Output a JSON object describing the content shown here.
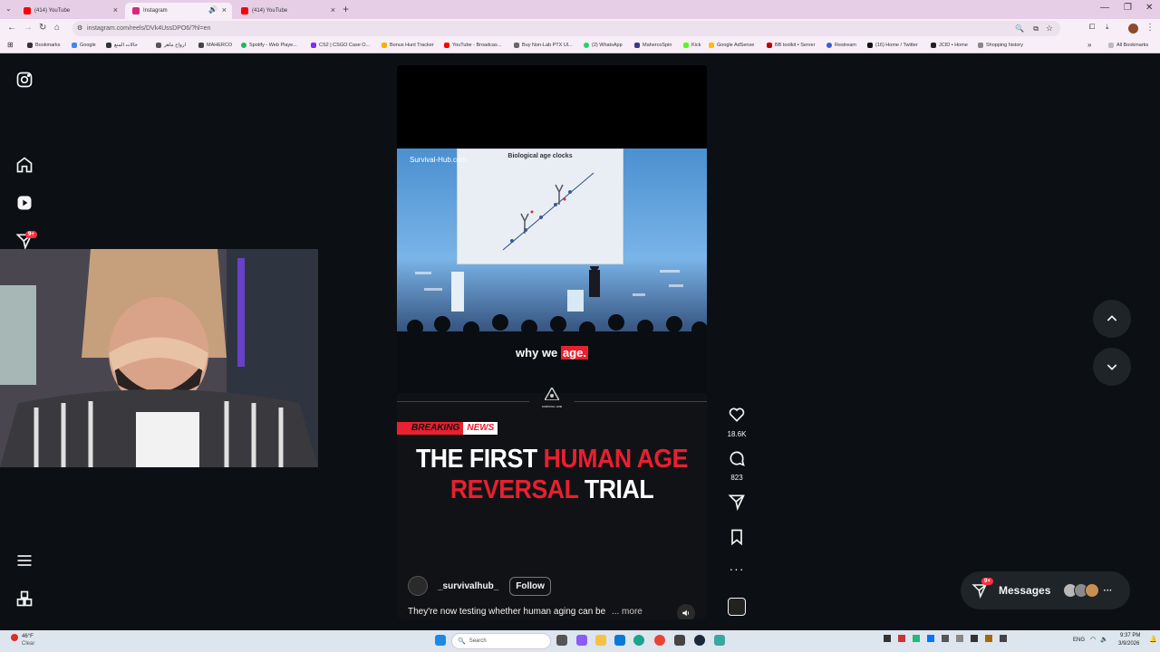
{
  "tabs": [
    {
      "title": "(414) YouTube",
      "active": false,
      "color": "#ff0000"
    },
    {
      "title": "Instagram",
      "active": true,
      "color": "#d62976"
    },
    {
      "title": "(414) YouTube",
      "active": false,
      "color": "#ff0000"
    }
  ],
  "window_controls": {
    "minimize": "—",
    "restore": "❐",
    "close": "✕"
  },
  "address_bar": {
    "url": "instagram.com/reels/DVk4UssDPO6/?hl=en"
  },
  "bookmarks": [
    {
      "label": "Bookmarks",
      "color": "#333333"
    },
    {
      "label": "Google",
      "color": "#4285f4"
    },
    {
      "label": "حالات المنع",
      "color": "#333333"
    },
    {
      "label": "ارواح ماهر",
      "color": "#555555"
    },
    {
      "label": "MAHERCO",
      "color": "#444444"
    },
    {
      "label": "Spotify - Web Playe...",
      "color": "#1db954"
    },
    {
      "label": "CS2 | CSGO Case O...",
      "color": "#7b2ff7"
    },
    {
      "label": "Bonus Hunt Tracker",
      "color": "#f0b400"
    },
    {
      "label": "YouTube - Broadcas...",
      "color": "#ff0000"
    },
    {
      "label": "Buy Non-Lab PTX Ul...",
      "color": "#666666"
    },
    {
      "label": "(2) WhatsApp",
      "color": "#25d366"
    },
    {
      "label": "MahercoSpin",
      "color": "#3a3a8a"
    },
    {
      "label": "Kick",
      "color": "#53fc18"
    },
    {
      "label": "Google AdSense",
      "color": "#fbbc04"
    },
    {
      "label": "BB toolkit • Server",
      "color": "#c00000"
    },
    {
      "label": "Restream",
      "color": "#3b5bdb"
    },
    {
      "label": "(16) Home / Twitter",
      "color": "#111111"
    },
    {
      "label": "JCID • Home",
      "color": "#222222"
    },
    {
      "label": "Shopping history",
      "color": "#888888"
    }
  ],
  "all_bookmarks": "All Bookmarks",
  "sidebar": {
    "notification_badge": "9+",
    "icons": [
      "instagram-logo-icon",
      "home-icon",
      "reels-icon",
      "share-icon",
      "menu-icon",
      "more-apps-icon"
    ]
  },
  "reel": {
    "watermark": "Survival-Hub.com",
    "slide_title": "Biological age clocks",
    "subtitle_plain": "why we",
    "subtitle_highlight": "age.",
    "logo_text": "SURVIVAL HUB",
    "breaking": "BREAKING",
    "news": "NEWS",
    "headline": {
      "line1_white": "THE FIRST",
      "line1_red": "HUMAN AGE",
      "line2_red": "REVERSAL",
      "line2_white": "TRIAL"
    },
    "username": "_survivalhub_",
    "follow_label": "Follow",
    "caption": "They're now testing whether human aging can be",
    "more_label": "... more"
  },
  "actions": {
    "likes": "18.6K",
    "comments": "823"
  },
  "messages": {
    "label": "Messages",
    "badge": "9+"
  },
  "taskbar": {
    "weather_temp": "46°F",
    "weather_desc": "Clear",
    "search_placeholder": "Search",
    "time": "9:37 PM",
    "date": "3/9/2026",
    "lang": "ENG"
  },
  "colors": {
    "accent_red": "#e8202f",
    "ig_dark": "#0c1014",
    "badge_red": "#ff3040"
  }
}
